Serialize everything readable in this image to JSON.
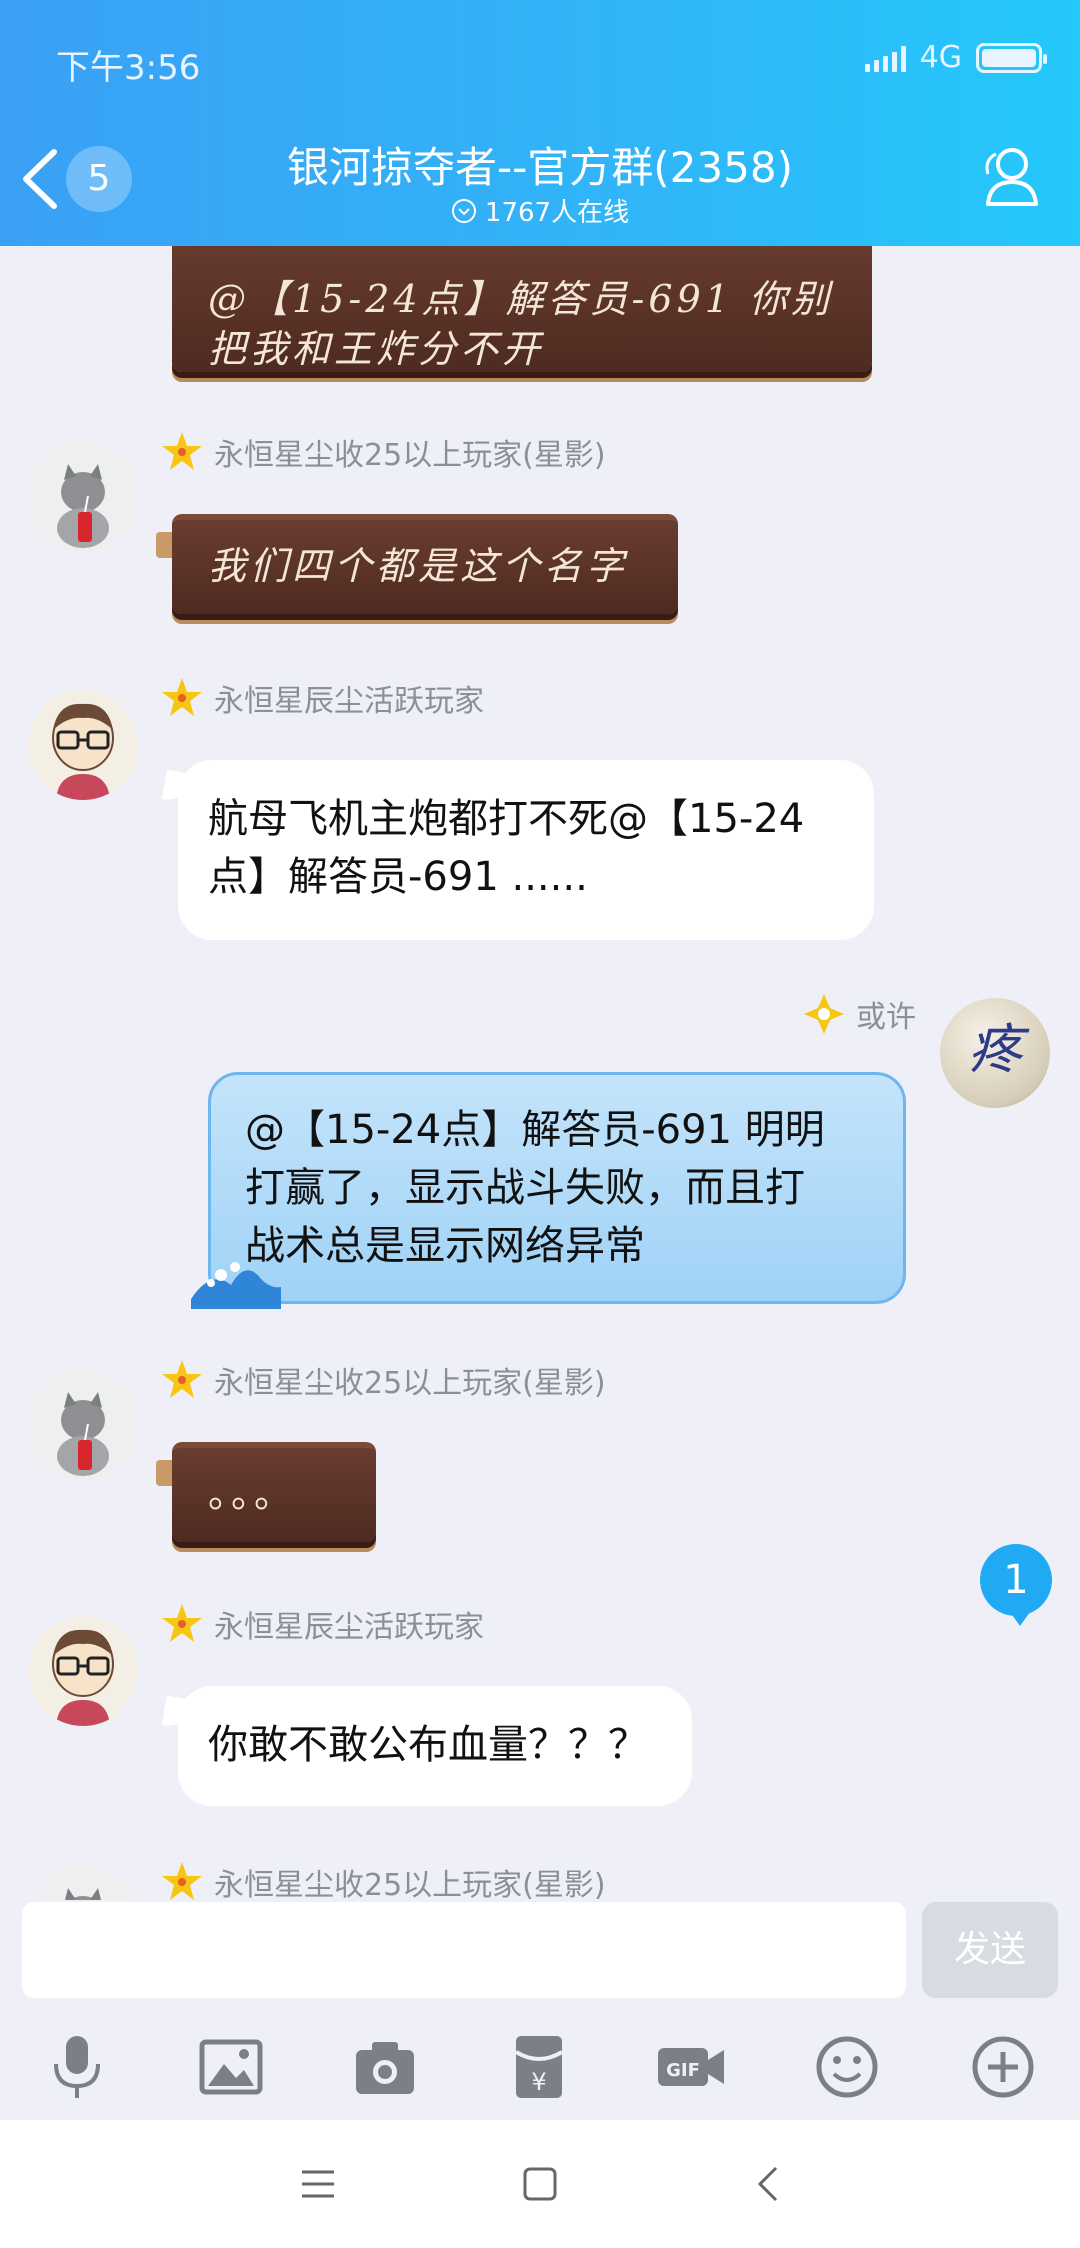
{
  "status_bar": {
    "time": "下午3:56",
    "network": "4G"
  },
  "header": {
    "unread_count": "5",
    "title": "银河掠夺者--官方群(2358)",
    "online": "1767人在线"
  },
  "messages": [
    {
      "type": "chocolate",
      "text_line1": "@【15-24点】解答员-691 你别",
      "text_line2": "把我和王炸分不开"
    },
    {
      "sender": "永恒星尘收25以上玩家(星影)",
      "type": "chocolate",
      "text": "我们四个都是这个名字",
      "avatar": "cat-avatar"
    },
    {
      "sender": "永恒星辰尘活跃玩家",
      "type": "white",
      "text_line1": "航母飞机主炮都打不死@【15-24",
      "text_line2": "点】解答员-691 ......",
      "avatar": "glasses-avatar"
    },
    {
      "sender": "或许",
      "type": "blue",
      "text_line1": "@【15-24点】解答员-691 明明",
      "text_line2": "打赢了，显示战斗失败，而且打",
      "text_line3": "战术总是显示网络异常",
      "avatar": "ball-avatar",
      "avatar_char": "疼"
    },
    {
      "sender": "永恒星尘收25以上玩家(星影)",
      "type": "chocolate",
      "text": "。。。",
      "avatar": "cat-avatar"
    },
    {
      "sender": "永恒星辰尘活跃玩家",
      "type": "white",
      "text": "你敢不敢公布血量？？？",
      "avatar": "glasses-avatar"
    },
    {
      "sender": "永恒星尘收25以上玩家(星影)",
      "avatar": "cat-avatar"
    }
  ],
  "new_message_badge": "1",
  "input": {
    "placeholder": "",
    "send_label": "发送"
  },
  "toolbar_icons": [
    "microphone-icon",
    "image-icon",
    "camera-icon",
    "red-envelope-icon",
    "gif-icon",
    "emoji-icon",
    "plus-icon"
  ],
  "nav_icons": [
    "menu-icon",
    "home-icon",
    "back-icon"
  ],
  "colors": {
    "header_start": "#3aa0f5",
    "header_end": "#24c8fb",
    "background": "#eff0f7",
    "badge": "#20aaf4"
  }
}
